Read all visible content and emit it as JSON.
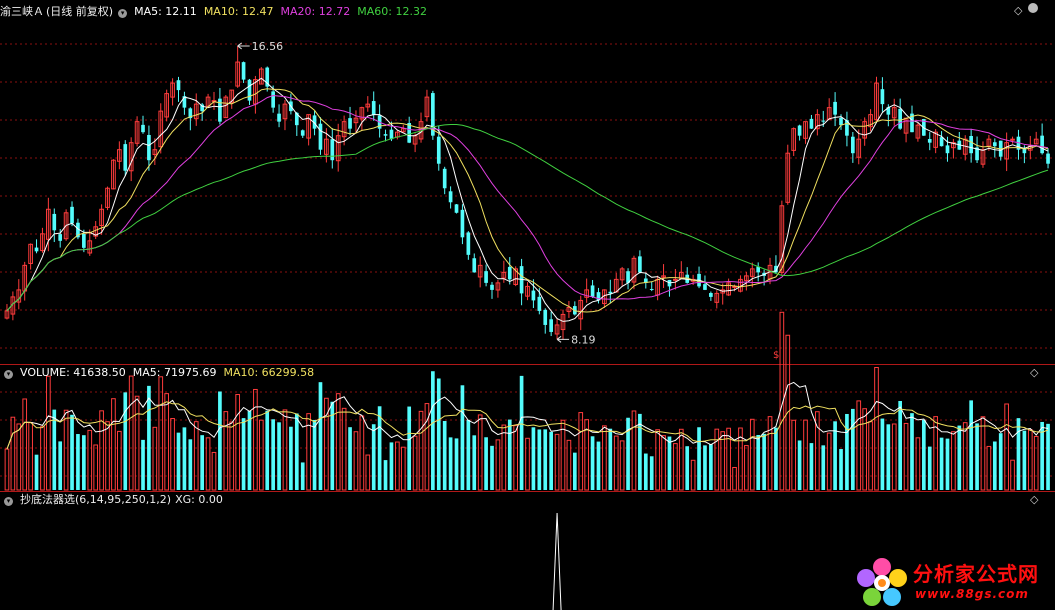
{
  "stock": {
    "name": "渝三峡Ａ",
    "mode": "(日线 前复权)"
  },
  "price_panel": {
    "ma_labels": [
      {
        "text": "MA5: 12.11",
        "color": "#ffffff"
      },
      {
        "text": "MA10: 12.47",
        "color": "#f0e060"
      },
      {
        "text": "MA20: 12.72",
        "color": "#e040e0"
      },
      {
        "text": "MA60: 12.32",
        "color": "#40d040"
      }
    ],
    "high_label": "16.56",
    "low_label": "8.19",
    "marker_label": "$"
  },
  "volume_panel": {
    "labels": [
      {
        "text": "VOLUME: 41638.50",
        "color": "#ffffff"
      },
      {
        "text": "MA5: 71975.69",
        "color": "#ffffff"
      },
      {
        "text": "MA10: 66299.58",
        "color": "#f0e060"
      }
    ]
  },
  "indicator_panel": {
    "name": "抄底法器选(6,14,95,250,1,2)",
    "xg": "XG: 0.00"
  },
  "logo": {
    "name": "分析家公式网",
    "url": "www.88gs.com"
  },
  "colors": {
    "up": "#ff3c3c",
    "down": "#54fcfc",
    "ma5": "#ffffff",
    "ma10": "#f0e060",
    "ma20": "#e040e0",
    "ma60": "#40d040",
    "grid": "#8a1010",
    "divider": "#b01818"
  },
  "chart_data": {
    "type": "candlestick",
    "price_range": [
      7.6,
      17.3
    ],
    "volume_range": [
      0,
      115000
    ],
    "key_points": {
      "high": 16.56,
      "low": 8.19
    },
    "close": [
      9.0,
      9.4,
      9.6,
      10.3,
      10.9,
      10.7,
      11.2,
      11.9,
      11.3,
      11.0,
      11.8,
      11.5,
      11.1,
      10.8,
      11.0,
      11.4,
      11.9,
      12.5,
      13.3,
      13.6,
      13.0,
      13.8,
      14.4,
      14.1,
      13.3,
      13.6,
      14.7,
      15.2,
      15.5,
      15.3,
      14.8,
      14.5,
      14.9,
      14.7,
      15.1,
      15.0,
      14.4,
      15.1,
      15.3,
      16.1,
      15.6,
      15.0,
      15.6,
      15.9,
      15.4,
      14.8,
      14.4,
      14.9,
      14.7,
      14.3,
      14.0,
      14.6,
      14.2,
      13.6,
      13.9,
      13.3,
      14.0,
      14.4,
      14.2,
      14.5,
      14.8,
      14.9,
      14.6,
      14.2,
      14.0,
      13.9,
      14.1,
      14.2,
      13.8,
      14.0,
      14.4,
      15.1,
      14.0,
      13.2,
      12.5,
      12.1,
      11.8,
      11.1,
      10.6,
      10.1,
      10.3,
      9.8,
      9.6,
      9.8,
      10.1,
      9.9,
      10.2,
      9.5,
      9.7,
      9.3,
      9.0,
      8.6,
      8.4,
      8.6,
      8.9,
      9.1,
      8.9,
      9.3,
      9.6,
      9.4,
      9.3,
      9.6,
      9.5,
      9.9,
      10.2,
      9.8,
      10.5,
      10.1,
      9.8,
      9.6,
      9.9,
      10.0,
      9.7,
      9.9,
      10.1,
      9.8,
      9.9,
      9.7,
      9.6,
      9.4,
      9.5,
      9.6,
      9.8,
      9.7,
      9.9,
      10.0,
      10.2,
      10.1,
      10.0,
      10.3,
      10.1,
      12.0,
      13.5,
      14.2,
      14.0,
      14.4,
      14.2,
      14.6,
      14.4,
      14.8,
      14.6,
      14.3,
      14.0,
      13.5,
      13.9,
      14.4,
      14.6,
      15.5,
      14.9,
      14.6,
      14.8,
      14.2,
      14.5,
      14.1,
      14.3,
      14.0,
      13.8,
      14.1,
      13.7,
      13.5,
      13.8,
      13.6,
      13.9,
      13.5,
      13.3,
      13.6,
      13.9,
      13.7,
      13.4,
      13.8,
      13.9,
      13.6,
      13.5,
      13.7,
      13.9,
      13.5,
      13.2
    ]
  }
}
